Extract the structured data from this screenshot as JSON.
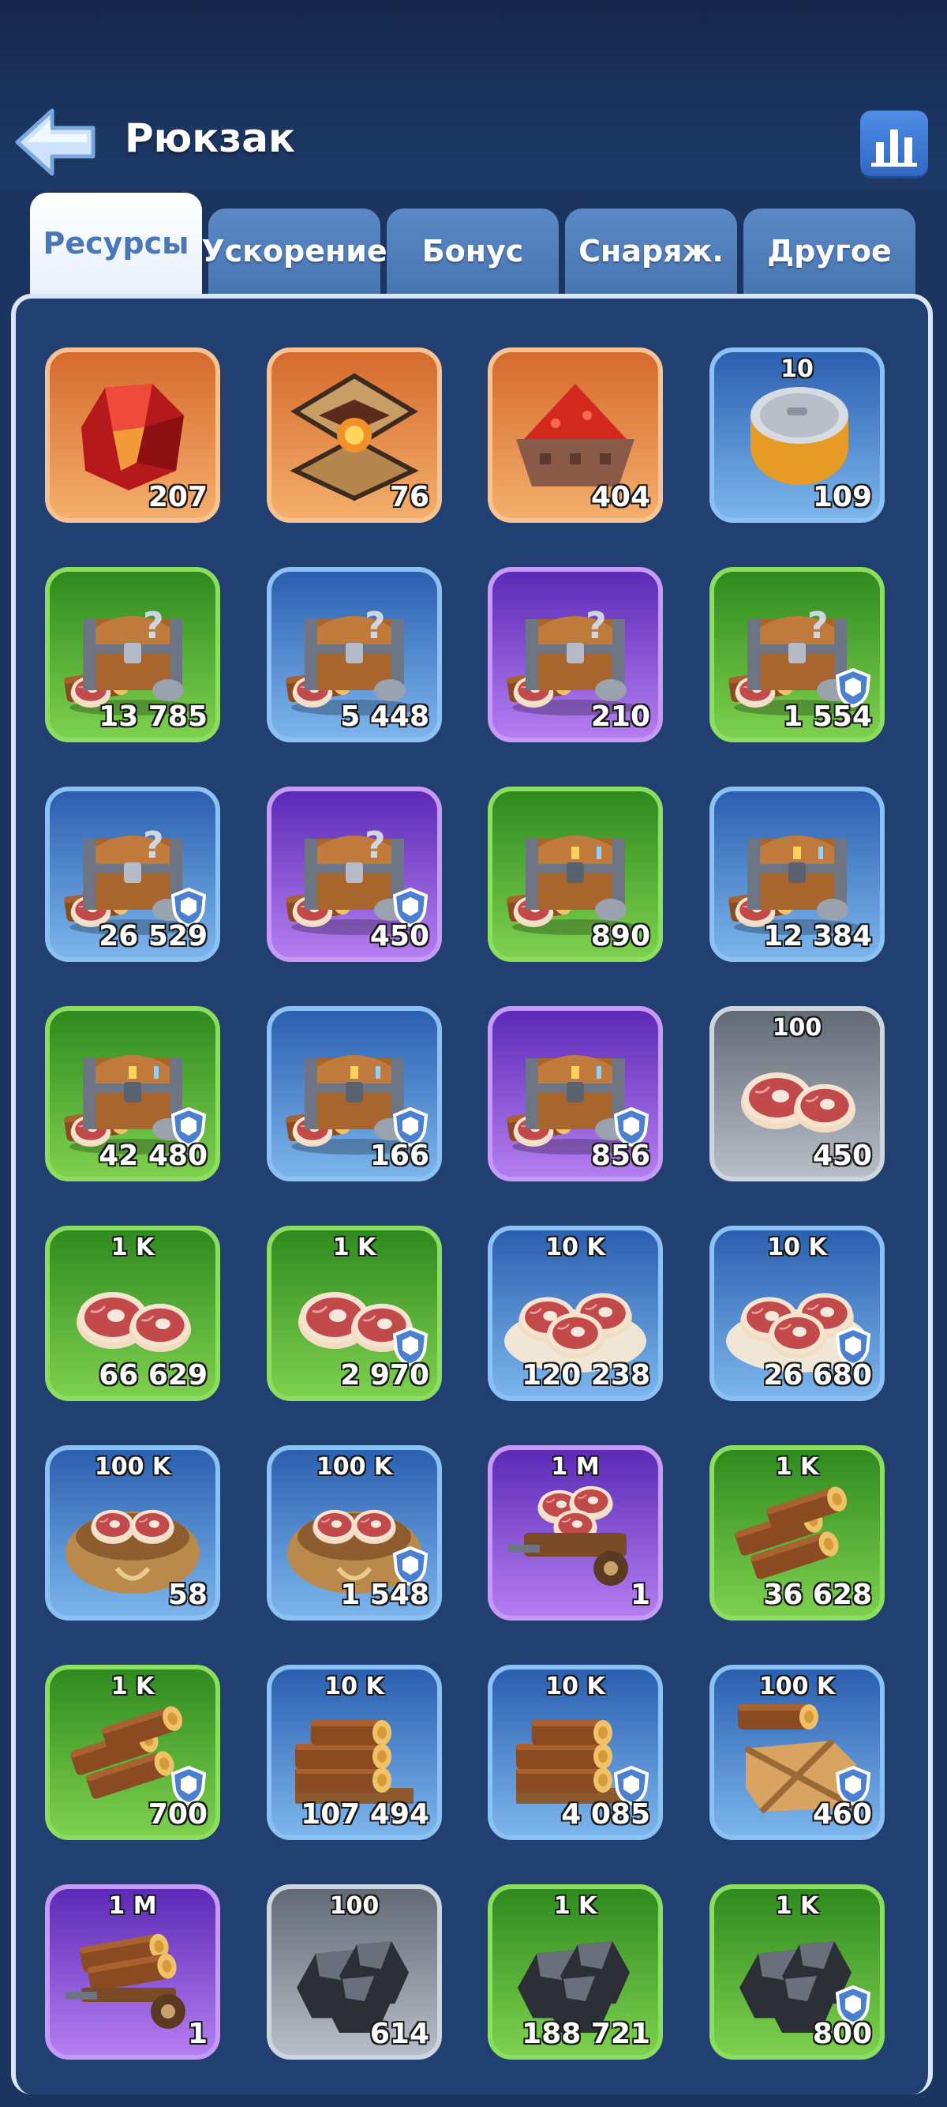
{
  "header": {
    "title": "Рюкзак",
    "back_icon": "back-arrow-icon",
    "stats_icon": "bar-chart-icon"
  },
  "tabs": [
    {
      "label": "Ресурсы",
      "active": true
    },
    {
      "label": "Ускорение",
      "active": false
    },
    {
      "label": "Бонус",
      "active": false
    },
    {
      "label": "Снаряж.",
      "active": false
    },
    {
      "label": "Другое",
      "active": false
    }
  ],
  "colors": {
    "orange": "#f19a57",
    "blue": "#5a91d8",
    "green": "#56b236",
    "purple": "#8c55dc",
    "grey": "#8c94a0"
  },
  "items": [
    {
      "name": "red-crystal",
      "icon": "crystal-icon",
      "rarity": "orange",
      "denom": "",
      "count": "207",
      "shield": false
    },
    {
      "name": "forge-core",
      "icon": "forge-icon",
      "rarity": "orange",
      "denom": "",
      "count": "76",
      "shield": false
    },
    {
      "name": "ore-cart",
      "icon": "ore-cart-icon",
      "rarity": "orange",
      "denom": "",
      "count": "404",
      "shield": false
    },
    {
      "name": "canned-food",
      "icon": "can-icon",
      "rarity": "blue",
      "denom": "10",
      "count": "109",
      "shield": false
    },
    {
      "name": "resource-chest",
      "icon": "mystery-chest-icon",
      "rarity": "green",
      "denom": "",
      "count": "13 785",
      "shield": false
    },
    {
      "name": "resource-chest",
      "icon": "mystery-chest-icon",
      "rarity": "blue",
      "denom": "",
      "count": "5 448",
      "shield": false
    },
    {
      "name": "resource-chest",
      "icon": "mystery-chest-icon",
      "rarity": "purple",
      "denom": "",
      "count": "210",
      "shield": false
    },
    {
      "name": "resource-chest",
      "icon": "mystery-chest-icon",
      "rarity": "green",
      "denom": "",
      "count": "1 554",
      "shield": true
    },
    {
      "name": "resource-chest",
      "icon": "mystery-chest-icon",
      "rarity": "blue",
      "denom": "",
      "count": "26 529",
      "shield": true
    },
    {
      "name": "resource-chest",
      "icon": "mystery-chest-icon",
      "rarity": "purple",
      "denom": "",
      "count": "450",
      "shield": true
    },
    {
      "name": "choice-chest",
      "icon": "choice-chest-icon",
      "rarity": "green",
      "denom": "",
      "count": "890",
      "shield": false
    },
    {
      "name": "choice-chest",
      "icon": "choice-chest-icon",
      "rarity": "blue",
      "denom": "",
      "count": "12 384",
      "shield": false
    },
    {
      "name": "choice-chest",
      "icon": "choice-chest-icon",
      "rarity": "green",
      "denom": "",
      "count": "42 480",
      "shield": true
    },
    {
      "name": "choice-chest",
      "icon": "choice-chest-icon",
      "rarity": "blue",
      "denom": "",
      "count": "166",
      "shield": true
    },
    {
      "name": "choice-chest",
      "icon": "choice-chest-icon",
      "rarity": "purple",
      "denom": "",
      "count": "856",
      "shield": true
    },
    {
      "name": "meat",
      "icon": "meat-icon",
      "rarity": "grey",
      "denom": "100",
      "count": "450",
      "shield": false
    },
    {
      "name": "meat",
      "icon": "meat-icon",
      "rarity": "green",
      "denom": "1 K",
      "count": "66 629",
      "shield": false
    },
    {
      "name": "meat",
      "icon": "meat-icon",
      "rarity": "green",
      "denom": "1 K",
      "count": "2 970",
      "shield": true
    },
    {
      "name": "meat-plate",
      "icon": "meat-plate-icon",
      "rarity": "blue",
      "denom": "10 K",
      "count": "120 238",
      "shield": false
    },
    {
      "name": "meat-plate",
      "icon": "meat-plate-icon",
      "rarity": "blue",
      "denom": "10 K",
      "count": "26 680",
      "shield": true
    },
    {
      "name": "meat-sack",
      "icon": "meat-sack-icon",
      "rarity": "blue",
      "denom": "100 K",
      "count": "58",
      "shield": false
    },
    {
      "name": "meat-sack",
      "icon": "meat-sack-icon",
      "rarity": "blue",
      "denom": "100 K",
      "count": "1 548",
      "shield": true
    },
    {
      "name": "meat-cart",
      "icon": "meat-cart-icon",
      "rarity": "purple",
      "denom": "1 M",
      "count": "1",
      "shield": false
    },
    {
      "name": "wood",
      "icon": "logs-icon",
      "rarity": "green",
      "denom": "1 K",
      "count": "36 628",
      "shield": false
    },
    {
      "name": "wood",
      "icon": "logs-icon",
      "rarity": "green",
      "denom": "1 K",
      "count": "700",
      "shield": true
    },
    {
      "name": "wood-stack",
      "icon": "log-stack-icon",
      "rarity": "blue",
      "denom": "10 K",
      "count": "107 494",
      "shield": false
    },
    {
      "name": "wood-stack",
      "icon": "log-stack-icon",
      "rarity": "blue",
      "denom": "10 K",
      "count": "4 085",
      "shield": true
    },
    {
      "name": "wood-crate",
      "icon": "wood-crate-icon",
      "rarity": "blue",
      "denom": "100 K",
      "count": "460",
      "shield": true
    },
    {
      "name": "wood-cart",
      "icon": "wood-cart-icon",
      "rarity": "purple",
      "denom": "1 M",
      "count": "1",
      "shield": false
    },
    {
      "name": "coal",
      "icon": "coal-icon",
      "rarity": "grey",
      "denom": "100",
      "count": "614",
      "shield": false
    },
    {
      "name": "coal",
      "icon": "coal-icon",
      "rarity": "green",
      "denom": "1 K",
      "count": "188 721",
      "shield": false
    },
    {
      "name": "coal",
      "icon": "coal-icon",
      "rarity": "green",
      "denom": "1 K",
      "count": "800",
      "shield": true
    }
  ]
}
